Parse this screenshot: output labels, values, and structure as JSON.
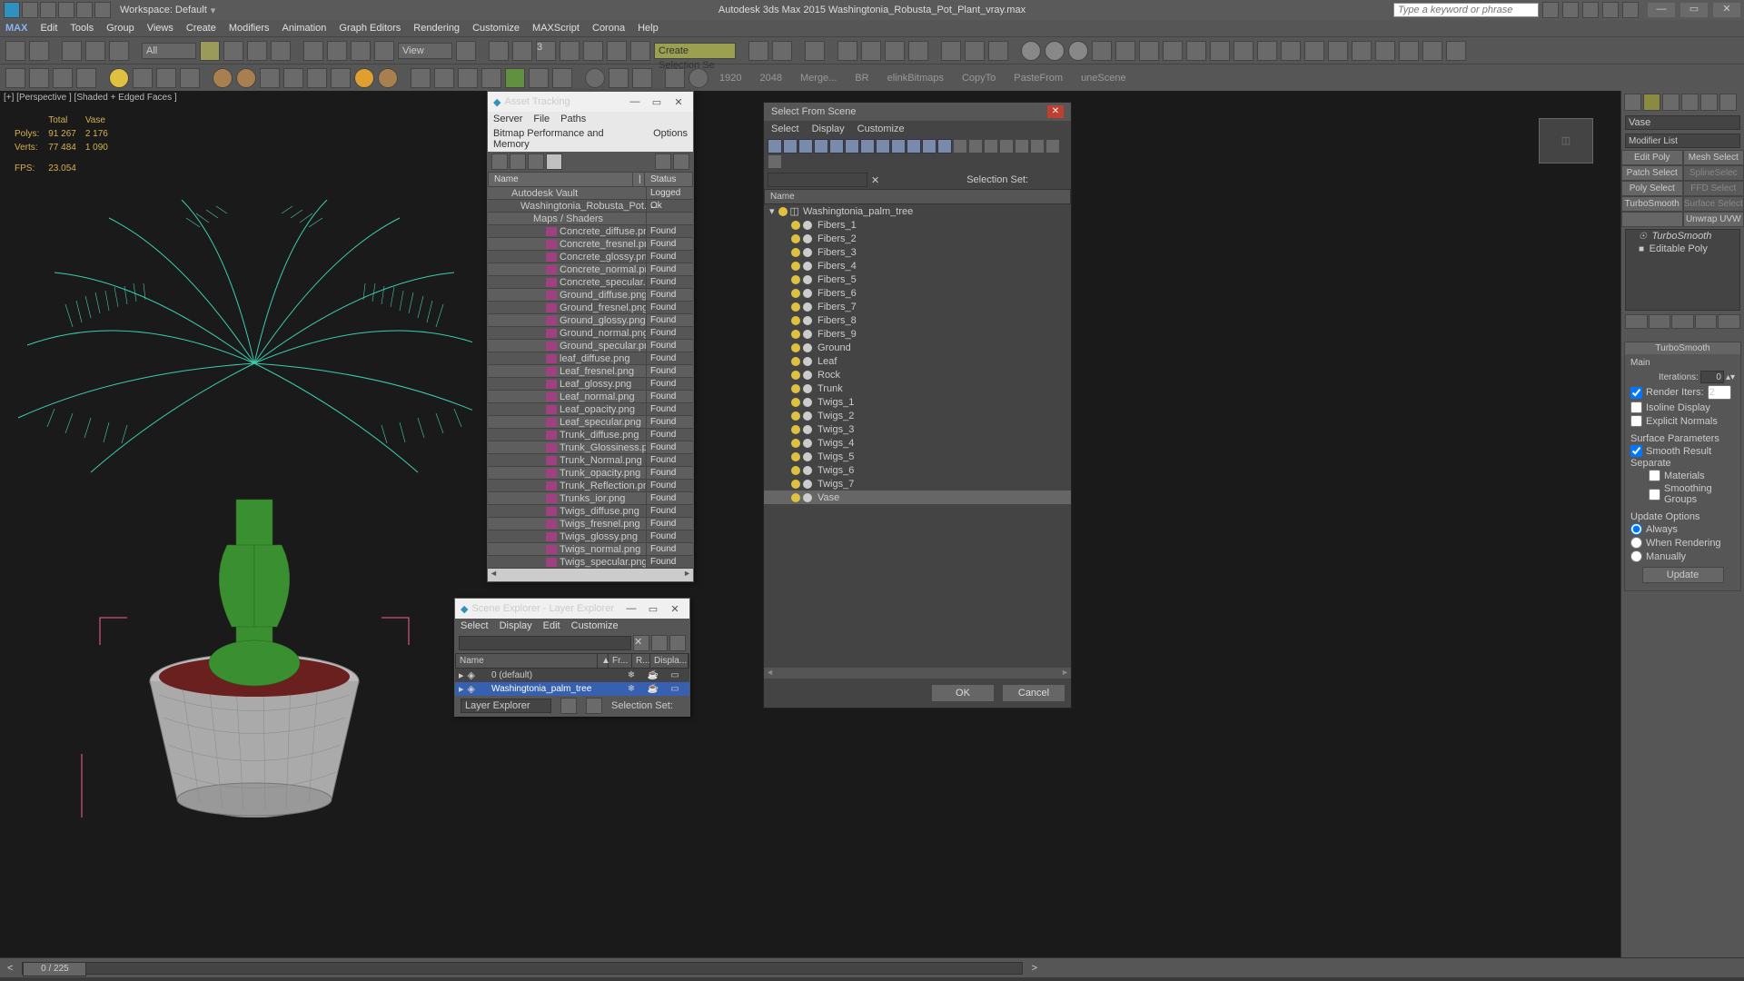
{
  "app": {
    "title": "Autodesk 3ds Max 2015    Washingtonia_Robusta_Pot_Plant_vray.max",
    "workspace": "Workspace: Default",
    "search_placeholder": "Type a keyword or phrase"
  },
  "menubar": [
    "Edit",
    "Tools",
    "Group",
    "Views",
    "Create",
    "Modifiers",
    "Animation",
    "Graph Editors",
    "Rendering",
    "Customize",
    "MAXScript",
    "Corona",
    "Help"
  ],
  "toolbar1": {
    "combo1": "All",
    "combo2": "View",
    "sel_combo": "Create Selection Se"
  },
  "toolbar2": {
    "labels": [
      "1920",
      "2048",
      "Merge...",
      "BR",
      "elinkBitmaps",
      "CopyTo",
      "PasteFrom",
      "uneScene"
    ]
  },
  "viewport": {
    "label": "[+] [Perspective ] [Shaded + Edged Faces ]",
    "stats": {
      "h1": "Total",
      "h2": "Vase",
      "polys_label": "Polys:",
      "polys_t": "91 267",
      "polys_v": "2 176",
      "verts_label": "Verts:",
      "verts_t": "77 484",
      "verts_v": "1 090",
      "fps_label": "FPS:",
      "fps": "23.054"
    }
  },
  "asset_tracking": {
    "title": "Asset Tracking",
    "menu": [
      "Server",
      "File",
      "Paths"
    ],
    "menu2": [
      "Bitmap Performance and Memory",
      "Options"
    ],
    "cols": {
      "name": "Name",
      "status": "Status"
    },
    "rows": [
      {
        "indent": 0,
        "name": "Autodesk Vault",
        "status": "Logged ..."
      },
      {
        "indent": 1,
        "name": "Washingtonia_Robusta_Pot...",
        "status": "Ok",
        "mark": "|"
      },
      {
        "indent": 2,
        "name": "Maps / Shaders",
        "status": ""
      },
      {
        "indent": 3,
        "name": "Concrete_diffuse.png",
        "status": "Found",
        "png": true
      },
      {
        "indent": 3,
        "name": "Concrete_fresnel.png",
        "status": "Found",
        "png": true
      },
      {
        "indent": 3,
        "name": "Concrete_glossy.png",
        "status": "Found",
        "png": true
      },
      {
        "indent": 3,
        "name": "Concrete_normal.png",
        "status": "Found",
        "png": true
      },
      {
        "indent": 3,
        "name": "Concrete_specular.png",
        "status": "Found",
        "png": true
      },
      {
        "indent": 3,
        "name": "Ground_diffuse.png",
        "status": "Found",
        "png": true
      },
      {
        "indent": 3,
        "name": "Ground_fresnel.png",
        "status": "Found",
        "png": true
      },
      {
        "indent": 3,
        "name": "Ground_glossy.png",
        "status": "Found",
        "png": true
      },
      {
        "indent": 3,
        "name": "Ground_normal.png",
        "status": "Found",
        "png": true
      },
      {
        "indent": 3,
        "name": "Ground_specular.png",
        "status": "Found",
        "png": true
      },
      {
        "indent": 3,
        "name": "leaf_diffuse.png",
        "status": "Found",
        "png": true
      },
      {
        "indent": 3,
        "name": "Leaf_fresnel.png",
        "status": "Found",
        "png": true
      },
      {
        "indent": 3,
        "name": "Leaf_glossy.png",
        "status": "Found",
        "png": true
      },
      {
        "indent": 3,
        "name": "Leaf_normal.png",
        "status": "Found",
        "png": true
      },
      {
        "indent": 3,
        "name": "Leaf_opacity.png",
        "status": "Found",
        "png": true
      },
      {
        "indent": 3,
        "name": "Leaf_specular.png",
        "status": "Found",
        "png": true
      },
      {
        "indent": 3,
        "name": "Trunk_diffuse.png",
        "status": "Found",
        "png": true
      },
      {
        "indent": 3,
        "name": "Trunk_Glossiness.png",
        "status": "Found",
        "png": true
      },
      {
        "indent": 3,
        "name": "Trunk_Normal.png",
        "status": "Found",
        "png": true
      },
      {
        "indent": 3,
        "name": "Trunk_opacity.png",
        "status": "Found",
        "png": true
      },
      {
        "indent": 3,
        "name": "Trunk_Reflection.png",
        "status": "Found",
        "png": true
      },
      {
        "indent": 3,
        "name": "Trunks_ior.png",
        "status": "Found",
        "png": true
      },
      {
        "indent": 3,
        "name": "Twigs_diffuse.png",
        "status": "Found",
        "png": true
      },
      {
        "indent": 3,
        "name": "Twigs_fresnel.png",
        "status": "Found",
        "png": true
      },
      {
        "indent": 3,
        "name": "Twigs_glossy.png",
        "status": "Found",
        "png": true
      },
      {
        "indent": 3,
        "name": "Twigs_normal.png",
        "status": "Found",
        "png": true
      },
      {
        "indent": 3,
        "name": "Twigs_specular.png",
        "status": "Found",
        "png": true
      }
    ]
  },
  "scene_explorer": {
    "title": "Scene Explorer - Layer Explorer",
    "menu": [
      "Select",
      "Display",
      "Edit",
      "Customize"
    ],
    "cols": [
      "Name",
      "▲",
      "Fr...",
      "R...",
      "Displa..."
    ],
    "rows": [
      {
        "name": "0 (default)",
        "sel": false
      },
      {
        "name": "Washingtonia_palm_tree",
        "sel": true
      }
    ],
    "status_l": "Layer Explorer",
    "status_r": "Selection Set:"
  },
  "select_from_scene": {
    "title": "Select From Scene",
    "menu": [
      "Select",
      "Display",
      "Customize"
    ],
    "selset": "Selection Set:",
    "col": "Name",
    "root": "Washingtonia_palm_tree",
    "items": [
      "Fibers_1",
      "Fibers_2",
      "Fibers_3",
      "Fibers_4",
      "Fibers_5",
      "Fibers_6",
      "Fibers_7",
      "Fibers_8",
      "Fibers_9",
      "Ground",
      "Leaf",
      "Rock",
      "Trunk",
      "Twigs_1",
      "Twigs_2",
      "Twigs_3",
      "Twigs_4",
      "Twigs_5",
      "Twigs_6",
      "Twigs_7"
    ],
    "selected": "Vase",
    "ok": "OK",
    "cancel": "Cancel"
  },
  "cmd": {
    "obj_name": "Vase",
    "modlist": "Modifier List",
    "btns": [
      [
        "Edit Poly",
        "Mesh Select"
      ],
      [
        "Patch Select",
        "SplineSelec"
      ],
      [
        "Poly Select",
        "FFD Select"
      ],
      [
        "TurboSmooth",
        "Surface Select"
      ],
      [
        "",
        "Unwrap UVW"
      ]
    ],
    "stack": [
      "TurboSmooth",
      "Editable Poly"
    ],
    "rollout": {
      "title": "TurboSmooth",
      "main": "Main",
      "iter": "Iterations:",
      "iter_v": "0",
      "rend": "Render Iters:",
      "rend_v": "2",
      "iso": "Isoline Display",
      "exp": "Explicit Normals",
      "surf": "Surface Parameters",
      "smooth": "Smooth Result",
      "sep": "Separate",
      "mat": "Materials",
      "sg": "Smoothing Groups",
      "upd": "Update Options",
      "always": "Always",
      "whenr": "When Rendering",
      "man": "Manually",
      "btn": "Update"
    }
  },
  "status": {
    "frame": "0 / 225"
  }
}
